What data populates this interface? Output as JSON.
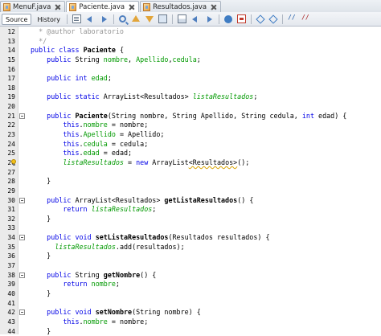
{
  "tabs": [
    {
      "label": "MenuF.java",
      "active": false
    },
    {
      "label": "Paciente.java",
      "active": true
    },
    {
      "label": "Resultados.java",
      "active": false
    }
  ],
  "toolbar": {
    "source_label": "Source",
    "history_label": "History",
    "icons": [
      "recent-files-icon",
      "back-icon",
      "forward-icon",
      "find-icon",
      "find-previous-icon",
      "find-next-icon",
      "toggle-highlight-icon",
      "toggle-bookmark-icon",
      "previous-bookmark-icon",
      "next-bookmark-icon",
      "start-macro-icon",
      "stop-macro-icon",
      "shift-left-icon",
      "shift-right-icon",
      "comment-icon",
      "uncomment-icon"
    ]
  },
  "colors": {
    "keyword": "#0000e6",
    "comment": "#969696",
    "field": "#009900",
    "gutter": "#ebebeb"
  },
  "lines": [
    {
      "n": "12",
      "html": "  <span class=\"cm\">* @author laboratorio</span>"
    },
    {
      "n": "13",
      "html": "  <span class=\"cm\">*/</span>"
    },
    {
      "n": "14",
      "html": "<span class=\"kw\">public class</span> <span class=\"b\">Paciente</span> {"
    },
    {
      "n": "15",
      "html": "    <span class=\"kw\">public</span> String <span class=\"fld\">nombre</span>, <span class=\"fld\">Apellido</span>,<span class=\"fld\">cedula</span>;"
    },
    {
      "n": "16",
      "html": ""
    },
    {
      "n": "17",
      "html": "    <span class=\"kw\">public int</span> <span class=\"fld\">edad</span>;"
    },
    {
      "n": "18",
      "html": ""
    },
    {
      "n": "19",
      "html": "    <span class=\"kw\">public static</span> ArrayList&lt;Resultados&gt; <span class=\"fld it\">listaResultados</span>;"
    },
    {
      "n": "20",
      "html": ""
    },
    {
      "n": "21",
      "html": "    <span class=\"kw\">public</span> <span class=\"b\">Paciente</span>(String nombre, String Apellido, String cedula, <span class=\"kw\">int</span> edad) {",
      "fold": true
    },
    {
      "n": "22",
      "html": "        <span class=\"kw\">this</span>.<span class=\"fld\">nombre</span> = nombre;"
    },
    {
      "n": "23",
      "html": "        <span class=\"kw\">this</span>.<span class=\"fld\">Apellido</span> = Apellido;"
    },
    {
      "n": "24",
      "html": "        <span class=\"kw\">this</span>.<span class=\"fld\">cedula</span> = cedula;"
    },
    {
      "n": "25",
      "html": "        <span class=\"kw\">this</span>.<span class=\"fld\">edad</span> = edad;"
    },
    {
      "n": "26",
      "html": "        <span class=\"fld it\">listaResultados</span> = <span class=\"kw\">new</span> ArrayList<span class=\"warn\">&lt;Resultados&gt;</span>();",
      "bulb": true
    },
    {
      "n": "27",
      "html": ""
    },
    {
      "n": "28",
      "html": "    }"
    },
    {
      "n": "29",
      "html": ""
    },
    {
      "n": "30",
      "html": "    <span class=\"kw\">public</span> ArrayList&lt;Resultados&gt; <span class=\"b\">getListaResultados</span>() {",
      "fold": true
    },
    {
      "n": "31",
      "html": "        <span class=\"kw\">return</span> <span class=\"fld it\">listaResultados</span>;"
    },
    {
      "n": "32",
      "html": "    }"
    },
    {
      "n": "33",
      "html": ""
    },
    {
      "n": "34",
      "html": "    <span class=\"kw\">public void</span> <span class=\"b\">setListaResultados</span>(Resultados resultados) {",
      "fold": true
    },
    {
      "n": "35",
      "html": "      <span class=\"fld it\">listaResultados</span>.add(resultados);"
    },
    {
      "n": "36",
      "html": "    }"
    },
    {
      "n": "37",
      "html": ""
    },
    {
      "n": "38",
      "html": "    <span class=\"kw\">public</span> String <span class=\"b\">getNombre</span>() {",
      "fold": true
    },
    {
      "n": "39",
      "html": "        <span class=\"kw\">return</span> <span class=\"fld\">nombre</span>;"
    },
    {
      "n": "40",
      "html": "    }"
    },
    {
      "n": "41",
      "html": ""
    },
    {
      "n": "42",
      "html": "    <span class=\"kw\">public void</span> <span class=\"b\">setNombre</span>(String nombre) {",
      "fold": true
    },
    {
      "n": "43",
      "html": "        <span class=\"kw\">this</span>.<span class=\"fld\">nombre</span> = nombre;"
    },
    {
      "n": "44",
      "html": "    }"
    }
  ]
}
